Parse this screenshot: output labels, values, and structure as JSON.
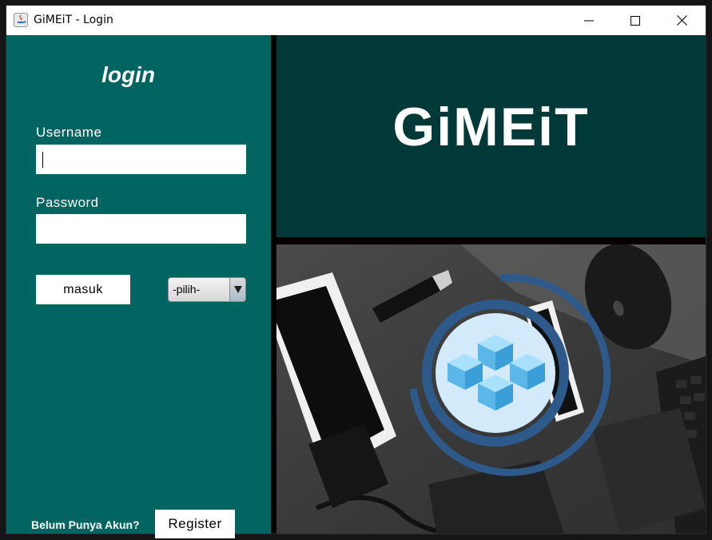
{
  "window": {
    "title": "GiMEiT - Login",
    "controls": {
      "minimize": "minimize-icon",
      "maximize": "maximize-icon",
      "close": "close-icon"
    }
  },
  "login": {
    "heading": "login",
    "username_label": "Username",
    "username_value": "",
    "password_label": "Password",
    "password_value": "",
    "submit_label": "masuk",
    "role_select": {
      "selected": "-pilih-"
    },
    "register_prompt": "Belum Punya Akun?",
    "register_label": "Register"
  },
  "brand": {
    "name": "GiMEiT",
    "logo": "cubes-logo-icon"
  },
  "colors": {
    "left_panel": "#006460",
    "brand_panel": "#003937",
    "logo_ring": "#2d5a8a",
    "logo_cube": "#5ab7e8"
  }
}
